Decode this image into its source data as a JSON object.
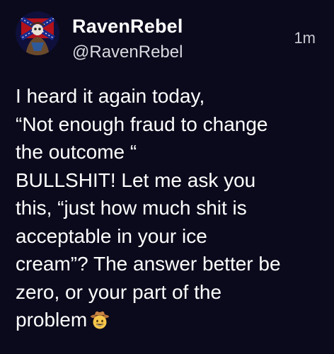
{
  "post": {
    "author": {
      "display_name": "RavenRebel",
      "handle": "@RavenRebel",
      "avatar_icon": "rebel-flag-skeleton-avatar"
    },
    "timestamp": "1m",
    "body_lines": [
      "I heard it again today,",
      "“Not enough fraud to change",
      "the outcome “",
      "BULLSHIT! Let me ask you",
      "this, “just how much shit is",
      "acceptable in your ice",
      "cream”? The answer better be",
      "zero, or your part of the",
      "problem"
    ],
    "trailing_emoji": "cowboy-hat-face-icon"
  },
  "colors": {
    "background": "#0b0a1c",
    "text": "#ffffff",
    "secondary_text": "#d9d9e0"
  }
}
